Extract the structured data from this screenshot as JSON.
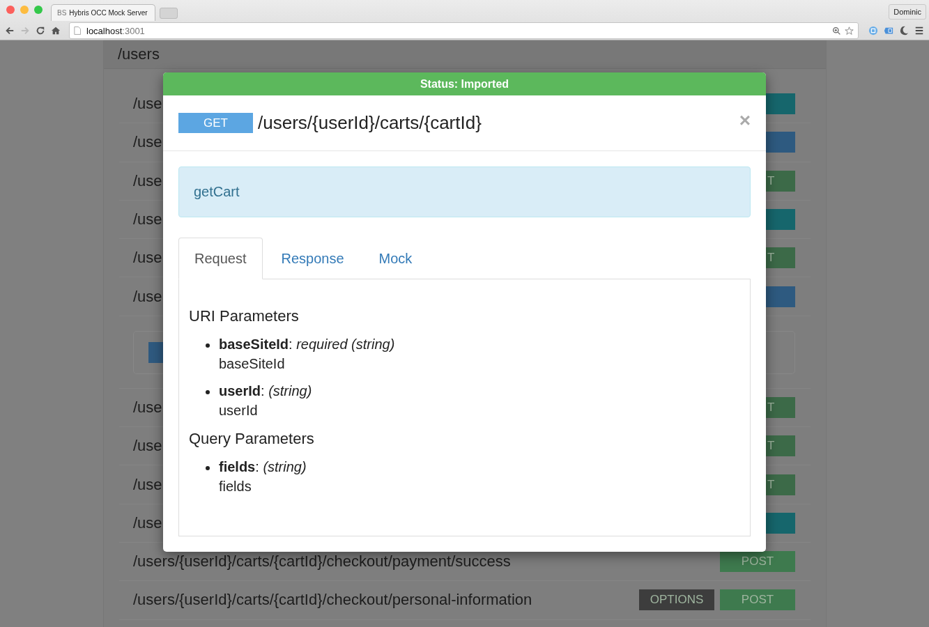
{
  "browser": {
    "tab_favicon": "BS",
    "tab_title": "Hybris OCC Mock Server",
    "address_host": "localhost",
    "address_port": ":3001",
    "profile": "Dominic"
  },
  "page": {
    "heading": "/users",
    "rows": [
      {
        "kind": "route",
        "path": "/use",
        "badges": [
          {
            "kind": "fragment",
            "color": "#16666c"
          }
        ]
      },
      {
        "kind": "route",
        "path": "/use",
        "badges": [
          {
            "kind": "fragment",
            "color": "#2e5a80"
          }
        ]
      },
      {
        "kind": "route",
        "path": "/use",
        "badges": [
          {
            "kind": "fragment",
            "color": "#3c6a48",
            "label": "T"
          }
        ]
      },
      {
        "kind": "route",
        "path": "/use",
        "badges": [
          {
            "kind": "fragment",
            "color": "#16666c"
          }
        ]
      },
      {
        "kind": "route",
        "path": "/use",
        "badges": [
          {
            "kind": "fragment",
            "color": "#3c6a48",
            "label": "T"
          }
        ]
      },
      {
        "kind": "route",
        "path": "/use",
        "badges": [
          {
            "kind": "fragment",
            "color": "#2e5a80"
          }
        ]
      },
      {
        "kind": "panel"
      },
      {
        "kind": "route",
        "path": "/use",
        "badges": [
          {
            "kind": "fragment",
            "color": "#3c6a48",
            "label": "T"
          }
        ]
      },
      {
        "kind": "route",
        "path": "/use",
        "badges": [
          {
            "kind": "fragment",
            "color": "#3c6a48",
            "label": "T"
          }
        ]
      },
      {
        "kind": "route",
        "path": "/use",
        "badges": [
          {
            "kind": "fragment",
            "color": "#3c6a48",
            "label": "T"
          }
        ]
      },
      {
        "kind": "route",
        "path": "/use",
        "badges": [
          {
            "kind": "fragment",
            "color": "#16666c"
          }
        ]
      },
      {
        "kind": "route",
        "path": "/users/{userId}/carts/{cartId}/checkout/payment/success",
        "badges": [
          {
            "kind": "full",
            "color": "#3e7a4e",
            "label": "POST"
          }
        ]
      },
      {
        "kind": "route",
        "path": "/users/{userId}/carts/{cartId}/checkout/personal-information",
        "badges": [
          {
            "kind": "full",
            "color": "#3d3d3d",
            "label": "OPTIONS"
          },
          {
            "kind": "full",
            "color": "#3e7a4e",
            "label": "POST"
          }
        ]
      }
    ]
  },
  "modal": {
    "status": "Status: Imported",
    "method": "GET",
    "path": "/users/{userId}/carts/{cartId}",
    "close": "×",
    "summary": "getCart",
    "tabs": [
      {
        "label": "Request",
        "selected": true
      },
      {
        "label": "Response",
        "selected": false
      },
      {
        "label": "Mock",
        "selected": false
      }
    ],
    "sections": [
      {
        "heading": "URI Parameters",
        "params": [
          {
            "text": "**baseSiteId**: *required (string)*",
            "description": "baseSiteId"
          },
          {
            "text": "**userId**: *(string)*",
            "description": "userId"
          }
        ]
      },
      {
        "heading": "Query Parameters",
        "params": [
          {
            "text": "**fields**: *(string)*",
            "description": "fields"
          }
        ]
      }
    ]
  }
}
